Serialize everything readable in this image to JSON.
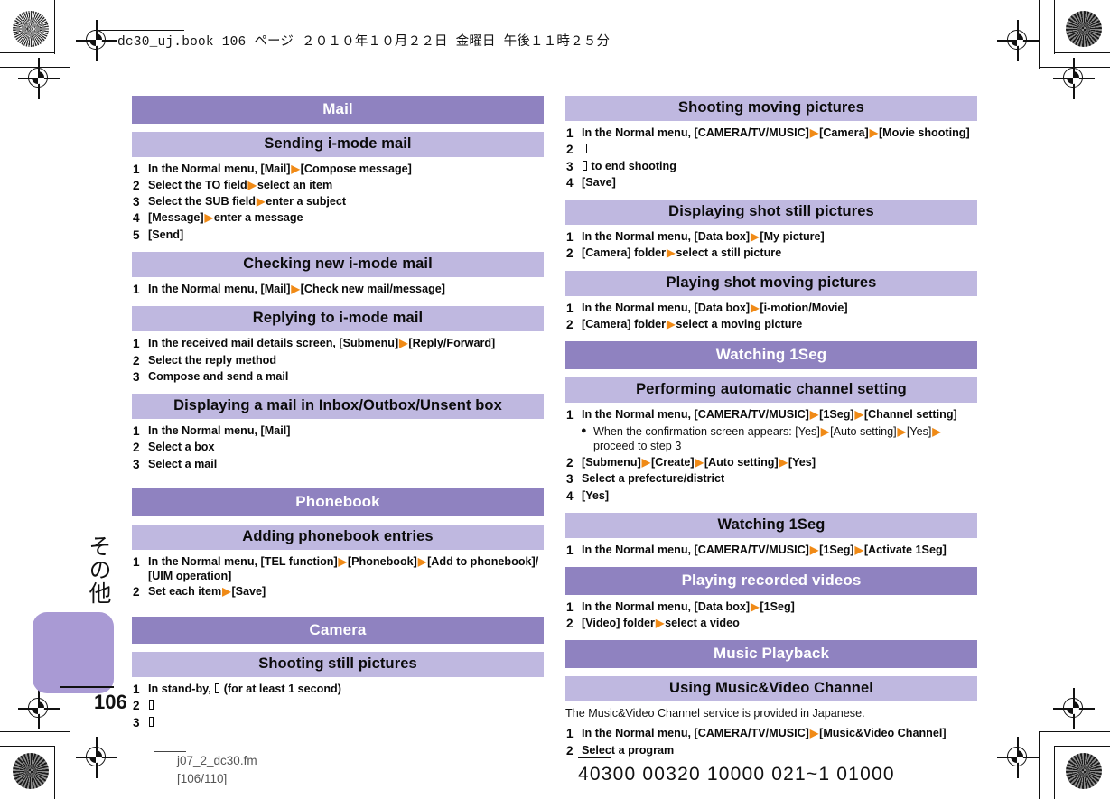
{
  "running_head": "dc30_uj.book   106 ページ   ２０１０年１０月２２日   金曜日   午後１１時２５分",
  "margin_tab": {
    "vertical_label": "その他",
    "page_number": "106"
  },
  "footer": {
    "file_name": "j07_2_dc30.fm",
    "page_range": "[106/110]",
    "print_code": "40300  00320  10000  021~1  01000"
  },
  "left_column": {
    "sections": [
      {
        "title": "Mail",
        "level": "h1",
        "subsections": [
          {
            "title": "Sending i-mode mail",
            "steps": [
              {
                "num": "1",
                "parts": [
                  "In the Normal menu, [Mail]",
                  "ARROW",
                  "[Compose message]"
                ]
              },
              {
                "num": "2",
                "parts": [
                  "Select the TO field",
                  "ARROW",
                  "select an item"
                ]
              },
              {
                "num": "3",
                "parts": [
                  "Select the SUB field",
                  "ARROW",
                  "enter a subject"
                ]
              },
              {
                "num": "4",
                "parts": [
                  "[Message]",
                  "ARROW",
                  "enter a message"
                ]
              },
              {
                "num": "5",
                "parts": [
                  "[Send]"
                ]
              }
            ]
          },
          {
            "title": "Checking new i-mode mail",
            "steps": [
              {
                "num": "1",
                "parts": [
                  "In the Normal menu, [Mail]",
                  "ARROW",
                  "[Check new mail/message]"
                ]
              }
            ]
          },
          {
            "title": "Replying to i-mode mail",
            "steps": [
              {
                "num": "1",
                "parts": [
                  "In the received mail details screen, [Submenu]",
                  "ARROW",
                  "[Reply/Forward]"
                ]
              },
              {
                "num": "2",
                "parts": [
                  "Select the reply method"
                ]
              },
              {
                "num": "3",
                "parts": [
                  "Compose and send a mail"
                ]
              }
            ]
          },
          {
            "title": "Displaying a mail in Inbox/Outbox/Unsent box",
            "steps": [
              {
                "num": "1",
                "parts": [
                  "In the Normal menu, [Mail]"
                ]
              },
              {
                "num": "2",
                "parts": [
                  "Select a box"
                ]
              },
              {
                "num": "3",
                "parts": [
                  "Select a mail"
                ]
              }
            ]
          }
        ]
      },
      {
        "title": "Phonebook",
        "level": "h1",
        "subsections": [
          {
            "title": "Adding phonebook entries",
            "steps": [
              {
                "num": "1",
                "parts": [
                  "In the Normal menu, [TEL function]",
                  "ARROW",
                  "[Phonebook]",
                  "ARROW",
                  "[Add to phonebook]/ [UIM operation]"
                ]
              },
              {
                "num": "2",
                "parts": [
                  "Set each item",
                  "ARROW",
                  "[Save]"
                ]
              }
            ]
          }
        ]
      },
      {
        "title": "Camera",
        "level": "h1",
        "subsections": [
          {
            "title": "Shooting still pictures",
            "steps": [
              {
                "num": "1",
                "parts": [
                  "In stand-by, ",
                  "GLYPH",
                  " (for at least 1 second)"
                ]
              },
              {
                "num": "2",
                "parts": [
                  "GLYPH"
                ]
              },
              {
                "num": "3",
                "parts": [
                  "GLYPH"
                ]
              }
            ]
          }
        ]
      }
    ]
  },
  "right_column": {
    "sections": [
      {
        "title": "Shooting moving pictures",
        "level": "h2",
        "steps": [
          {
            "num": "1",
            "parts": [
              "In the Normal menu, [CAMERA/TV/MUSIC]",
              "ARROW",
              "[Camera]",
              "ARROW",
              "[Movie shooting]"
            ]
          },
          {
            "num": "2",
            "parts": [
              "GLYPH"
            ]
          },
          {
            "num": "3",
            "parts": [
              "GLYPH",
              " to end shooting"
            ]
          },
          {
            "num": "4",
            "parts": [
              "[Save]"
            ]
          }
        ]
      },
      {
        "title": "Displaying shot still pictures",
        "level": "h2",
        "steps": [
          {
            "num": "1",
            "parts": [
              "In the Normal menu, [Data box]",
              "ARROW",
              "[My picture]"
            ]
          },
          {
            "num": "2",
            "parts": [
              "[Camera] folder",
              "ARROW",
              "select a still picture"
            ]
          }
        ]
      },
      {
        "title": "Playing shot moving pictures",
        "level": "h2",
        "steps": [
          {
            "num": "1",
            "parts": [
              "In the Normal menu, [Data box]",
              "ARROW",
              "[i-motion/Movie]"
            ]
          },
          {
            "num": "2",
            "parts": [
              "[Camera] folder",
              "ARROW",
              "select a moving picture"
            ]
          }
        ]
      },
      {
        "title": "Watching 1Seg",
        "level": "h1",
        "steps": []
      },
      {
        "title": "Performing automatic channel setting",
        "level": "h2",
        "steps": [
          {
            "num": "1",
            "parts": [
              "In the Normal menu, [CAMERA/TV/MUSIC]",
              "ARROW",
              "[1Seg]",
              "ARROW",
              "[Channel setting]"
            ]
          },
          {
            "bullet": true,
            "parts": [
              "When the confirmation screen appears: [Yes]",
              "ARROW",
              "[Auto setting]",
              "ARROW",
              "[Yes]",
              "ARROW",
              " proceed to step 3"
            ]
          },
          {
            "num": "2",
            "parts": [
              "[Submenu]",
              "ARROW",
              "[Create]",
              "ARROW",
              "[Auto setting]",
              "ARROW",
              "[Yes]"
            ]
          },
          {
            "num": "3",
            "parts": [
              "Select a prefecture/district"
            ]
          },
          {
            "num": "4",
            "parts": [
              "[Yes]"
            ]
          }
        ]
      },
      {
        "title": "Watching 1Seg",
        "level": "h2",
        "steps": [
          {
            "num": "1",
            "parts": [
              "In the Normal menu, [CAMERA/TV/MUSIC]",
              "ARROW",
              "[1Seg]",
              "ARROW",
              "[Activate 1Seg]"
            ]
          }
        ]
      },
      {
        "title": "Playing recorded videos",
        "level": "h1",
        "steps": [
          {
            "num": "1",
            "parts": [
              "In the Normal menu, [Data box]",
              "ARROW",
              "[1Seg]"
            ]
          },
          {
            "num": "2",
            "parts": [
              "[Video] folder",
              "ARROW",
              "select a video"
            ]
          }
        ]
      },
      {
        "title": "Music Playback",
        "level": "h1",
        "steps": []
      },
      {
        "title": "Using Music&Video Channel",
        "level": "h2",
        "note": "The Music&Video Channel service is provided in Japanese.",
        "steps": [
          {
            "num": "1",
            "parts": [
              "In the Normal menu, [CAMERA/TV/MUSIC]",
              "ARROW",
              "[Music&Video Channel]"
            ]
          },
          {
            "num": "2",
            "parts": [
              "Select a program"
            ]
          }
        ]
      }
    ]
  },
  "colors": {
    "header_dark": "#8f82c0",
    "header_light": "#bfb8e0",
    "arrow_orange": "#f08a16",
    "tab_block": "#a99ad4"
  }
}
